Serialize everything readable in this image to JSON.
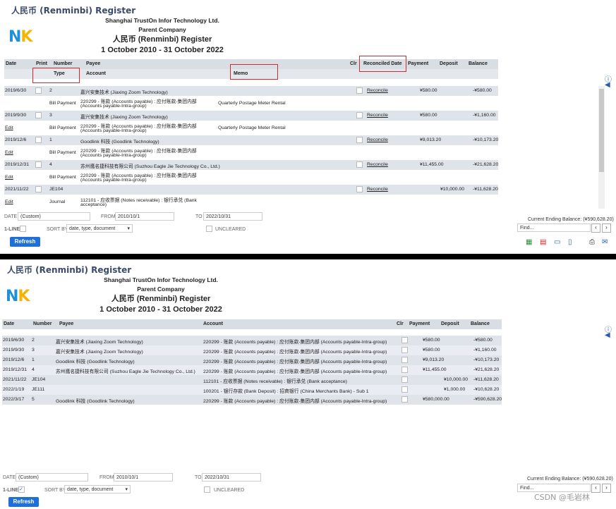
{
  "register_title": "人民币 (Renminbi) Register",
  "company": "Shanghai TrustOn Infor Technology Ltd.",
  "parent": "Parent Company",
  "report_title": "人民币 (Renminbi) Register",
  "period": "1 October 2010 - 31 October 2022",
  "logo": {
    "n": "N",
    "k": "K"
  },
  "top_headers": {
    "date": "Date",
    "print": "Print",
    "number": "Number",
    "payee": "Payee",
    "clr": "Clr",
    "reconciled": "Reconciled Date",
    "payment": "Payment",
    "deposit": "Deposit",
    "balance": "Balance",
    "type": "Type",
    "account": "Account",
    "memo": "Memo"
  },
  "top_rows": [
    {
      "date": "2019/6/30",
      "number": "2",
      "payee": "嘉兴安集技术 (Jiaxing Zoom Technology)",
      "type": "Bill Payment",
      "account1": "220299 - 账款 (Accounts payable) : 应付账款-集团内部",
      "account2": "(Accounts payable-Intra-group)",
      "memo": "Quarterly Postage Meter Rental",
      "reconcile": "Reconcile",
      "payment": "¥580.00",
      "deposit": "",
      "balance": "-¥580.00",
      "edit": ""
    },
    {
      "date": "2019/9/30",
      "number": "3",
      "payee": "嘉兴安集技术 (Jiaxing Zoom Technology)",
      "type": "Bill Payment",
      "account1": "220299 - 账款 (Accounts payable) : 应付账款-集团内部",
      "account2": "(Accounts payable-Intra-group)",
      "memo": "Quarterly Postage Meter Rental",
      "reconcile": "Reconcile",
      "payment": "¥580.00",
      "deposit": "",
      "balance": "-¥1,160.00",
      "edit": "Edit"
    },
    {
      "date": "2019/12/6",
      "number": "1",
      "payee": "Goodlink 科技 (Goodlink Technology)",
      "type": "Bill Payment",
      "account1": "220299 - 账款 (Accounts payable) : 应付账款-集团内部",
      "account2": "(Accounts payable-Intra-group)",
      "memo": "",
      "reconcile": "Reconcile",
      "payment": "¥9,013.20",
      "deposit": "",
      "balance": "-¥10,173.20",
      "edit": "Edit"
    },
    {
      "date": "2019/12/31",
      "number": "4",
      "payee": "苏州鹰名捷科技有限公司 (Suzhou Eagle Jie Technology Co., Ltd.)",
      "type": "Bill Payment",
      "account1": "220299 - 账款 (Accounts payable) : 应付账款-集团内部",
      "account2": "(Accounts payable-Intra-group)",
      "memo": "",
      "reconcile": "Reconcile",
      "payment": "¥11,455.00",
      "deposit": "",
      "balance": "-¥21,628.20",
      "edit": "Edit"
    },
    {
      "date": "2021/11/22",
      "number": "JE104",
      "payee": "",
      "type": "Journal",
      "account1": "112101 - 应收票据 (Notes receivable) : 银行承兑 (Bank",
      "account2": "acceptance)",
      "memo": "",
      "reconcile": "Reconcile",
      "payment": "",
      "deposit": "¥10,000.00",
      "balance": "-¥11,628.20",
      "edit": "Edit"
    }
  ],
  "last_edit": "Edit",
  "filters": {
    "date_label": "DATE",
    "date_value": "(Custom)",
    "from_label": "FROM",
    "from_value": "2010/10/1",
    "to_label": "TO",
    "to_value": "2022/10/31",
    "oneline": "1-LINE",
    "sort_label": "SORT BY",
    "sort_value": "date, type, document",
    "uncleared": "UNCLEARED",
    "ending_balance": "Current Ending Balance: (¥590,628.20)",
    "find_placeholder": "Find...",
    "refresh": "Refresh"
  },
  "bottom_headers": {
    "date": "Date",
    "number": "Number",
    "payee": "Payee",
    "account": "Account",
    "clr": "Clr",
    "payment": "Payment",
    "deposit": "Deposit",
    "balance": "Balance"
  },
  "bottom_rows": [
    {
      "date": "2019/6/30",
      "number": "2",
      "payee": "嘉兴安集技术 (Jiaxing Zoom Technology)",
      "account": "220299 - 账款 (Accounts payable) : 应付账款-集团内部 (Accounts payable-Intra-group)",
      "payment": "¥580.00",
      "deposit": "",
      "balance": "-¥580.00"
    },
    {
      "date": "2019/9/30",
      "number": "3",
      "payee": "嘉兴安集技术 (Jiaxing Zoom Technology)",
      "account": "220299 - 账款 (Accounts payable) : 应付账款-集团内部 (Accounts payable-Intra-group)",
      "payment": "¥580.00",
      "deposit": "",
      "balance": "-¥1,160.00"
    },
    {
      "date": "2019/12/6",
      "number": "1",
      "payee": "Goodlink 科技 (Goodlink Technology)",
      "account": "220299 - 账款 (Accounts payable) : 应付账款-集团内部 (Accounts payable-Intra-group)",
      "payment": "¥9,013.20",
      "deposit": "",
      "balance": "-¥10,173.20"
    },
    {
      "date": "2019/12/31",
      "number": "4",
      "payee": "苏州鹰名捷科技有限公司 (Suzhou Eagle Jie Technology Co., Ltd.)",
      "account": "220299 - 账款 (Accounts payable) : 应付账款-集团内部 (Accounts payable-Intra-group)",
      "payment": "¥11,455.00",
      "deposit": "",
      "balance": "-¥21,628.20"
    },
    {
      "date": "2021/11/22",
      "number": "JE104",
      "payee": "",
      "account": "112101 - 应收票据 (Notes receivable) : 银行承兑 (Bank acceptance)",
      "payment": "",
      "deposit": "¥10,000.00",
      "balance": "-¥11,628.20"
    },
    {
      "date": "2022/1/19",
      "number": "JE111",
      "payee": "",
      "account": "100201 - 银行存款 (Bank Deposit) : 招商银行 (China Merchants Bank) - Sub 1",
      "payment": "",
      "deposit": "¥1,000.00",
      "balance": "-¥10,628.20"
    },
    {
      "date": "2022/3/17",
      "number": "5",
      "payee": "Goodlink 科技 (Goodlink Technology)",
      "account": "220299 - 账款 (Accounts payable) : 应付账款-集团内部 (Accounts payable-Intra-group)",
      "payment": "¥580,000.00",
      "deposit": "",
      "balance": "-¥590,628.20"
    }
  ],
  "watermark": "CSDN @毛岩林",
  "colors": {
    "accent": "#1f6fd8",
    "highlight": "#d12b2b",
    "header_bg": "#d9dde4"
  }
}
